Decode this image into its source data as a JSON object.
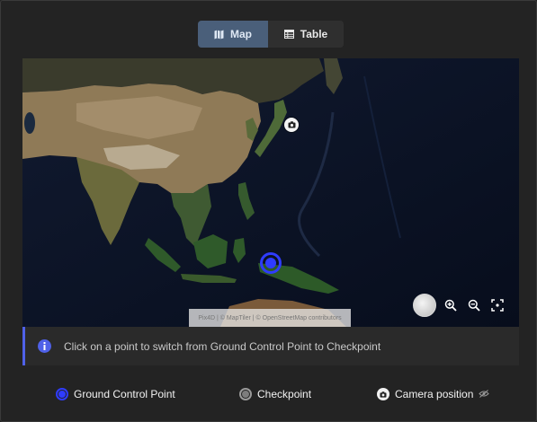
{
  "view_toggle": {
    "map_label": "Map",
    "table_label": "Table",
    "active": "Map"
  },
  "map": {
    "attribution": "Pix4D | © MapTiler | © OpenStreetMap contributors",
    "markers": [
      {
        "type": "camera-position"
      },
      {
        "type": "ground-control-point"
      }
    ]
  },
  "info": {
    "text": "Click on a point to switch from Ground Control Point to Checkpoint"
  },
  "legend": {
    "gcp_label": "Ground Control Point",
    "checkpoint_label": "Checkpoint",
    "camera_label": "Camera position"
  },
  "colors": {
    "gcp": "#2f3cff",
    "accent": "#4f61e8",
    "active_tab": "#4a5f7a"
  }
}
